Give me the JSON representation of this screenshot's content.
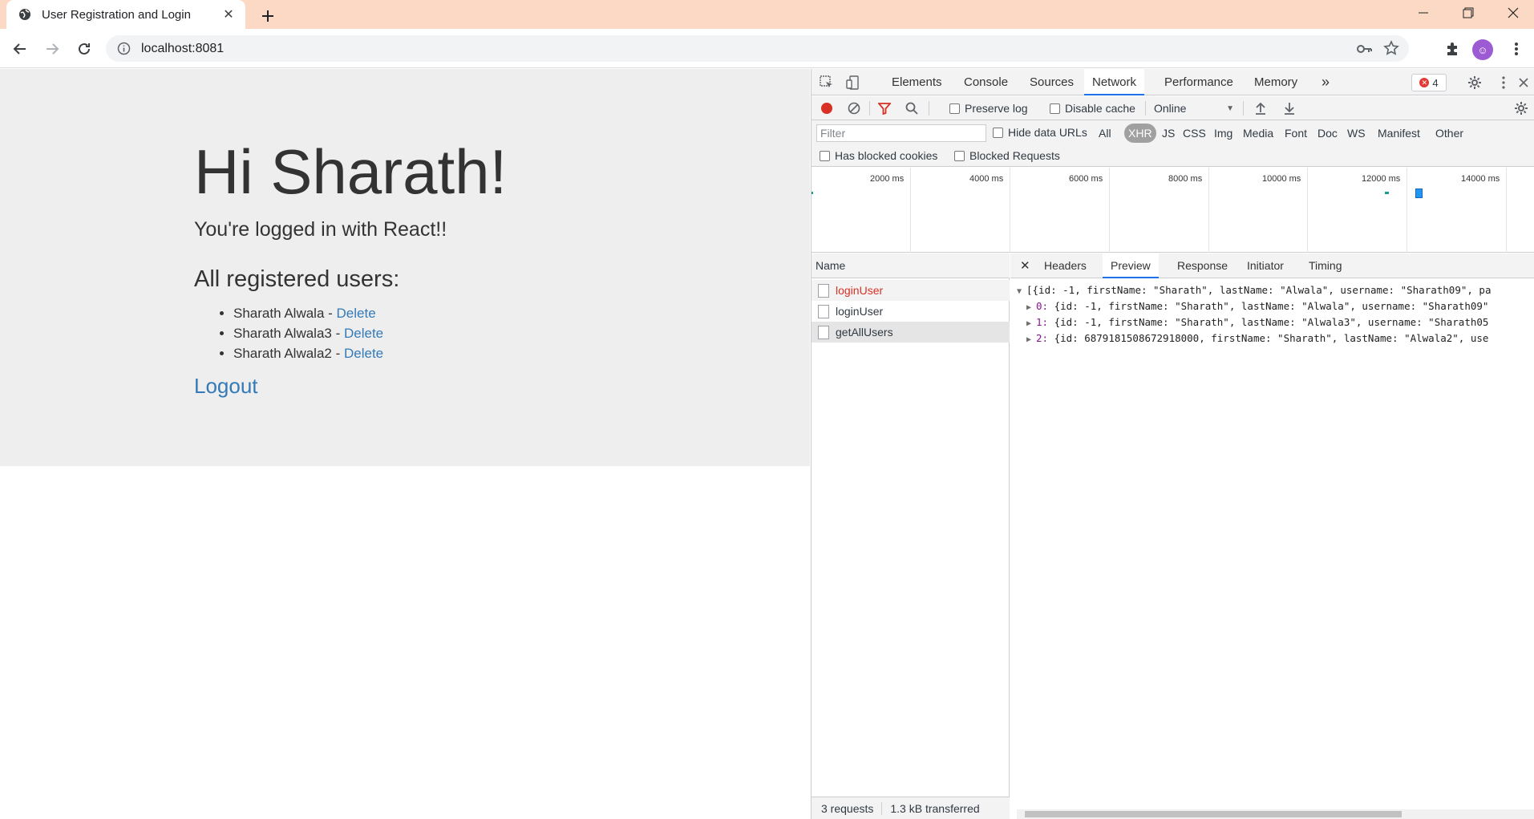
{
  "browser": {
    "tab_title": "User Registration and Login",
    "url": "localhost:8081"
  },
  "page": {
    "greeting": "Hi Sharath!",
    "subtitle": "You're logged in with React!!",
    "users_heading": "All registered users:",
    "users": [
      {
        "name": "Sharath Alwala",
        "sep": " - ",
        "action": "Delete"
      },
      {
        "name": "Sharath Alwala3",
        "sep": " - ",
        "action": "Delete"
      },
      {
        "name": "Sharath Alwala2",
        "sep": " - ",
        "action": "Delete"
      }
    ],
    "logout_label": "Logout",
    "colors": {
      "link": "#337ab7",
      "background": "#eeeeee"
    }
  },
  "devtools": {
    "tabs": [
      "Elements",
      "Console",
      "Sources",
      "Network",
      "Performance",
      "Memory"
    ],
    "active_tab": "Network",
    "more_tabs": "»",
    "error_count": "4",
    "preserve_log": "Preserve log",
    "disable_cache": "Disable cache",
    "throttle": "Online",
    "filter_placeholder": "Filter",
    "hide_data_urls": "Hide data URLs",
    "types": [
      "All",
      "XHR",
      "JS",
      "CSS",
      "Img",
      "Media",
      "Font",
      "Doc",
      "WS",
      "Manifest",
      "Other"
    ],
    "active_type": "XHR",
    "has_blocked_cookies": "Has blocked cookies",
    "blocked_requests": "Blocked Requests",
    "timeline_labels": [
      "2000 ms",
      "4000 ms",
      "6000 ms",
      "8000 ms",
      "10000 ms",
      "12000 ms",
      "14000 ms"
    ],
    "name_header": "Name",
    "requests": [
      "loginUser",
      "loginUser",
      "getAllUsers"
    ],
    "detail_tabs": [
      "Headers",
      "Preview",
      "Response",
      "Initiator",
      "Timing"
    ],
    "active_detail_tab": "Preview",
    "status_requests": "3 requests",
    "status_transferred": "1.3 kB transferred",
    "preview": {
      "root": "[{id: -1, firstName: \"Sharath\", lastName: \"Alwala\", username: \"Sharath09\", pa",
      "rows": [
        {
          "index": "0",
          "text": "{id: -1, firstName: \"Sharath\", lastName: \"Alwala\", username: \"Sharath09\""
        },
        {
          "index": "1",
          "text": "{id: -1, firstName: \"Sharath\", lastName: \"Alwala3\", username: \"Sharath05"
        },
        {
          "index": "2",
          "text": "{id: 6879181508672918000, firstName: \"Sharath\", lastName: \"Alwala2\", use"
        }
      ]
    }
  }
}
